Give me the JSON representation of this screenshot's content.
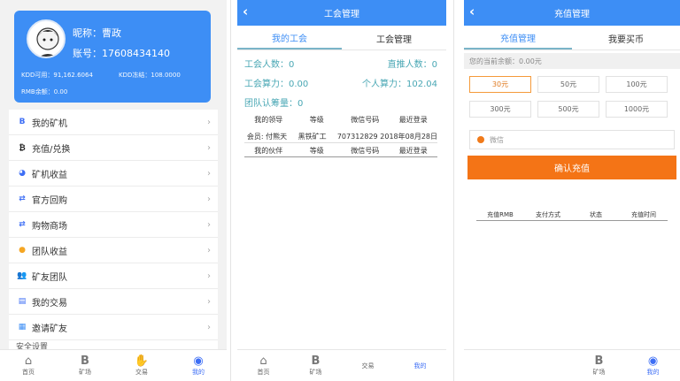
{
  "profile": {
    "nickname": "昵称：曹政",
    "account": "账号：17608434140",
    "available": "KDD可用：91,162.6064",
    "frozen": "KDD冻结：108.0000",
    "balance": "RMB余额：0.00"
  },
  "menu": [
    {
      "icon": "B",
      "icon_name": "bitcoin-b-icon",
      "label": "我的矿机"
    },
    {
      "icon": "₿",
      "icon_name": "bitcoin-icon",
      "label": "充值/兑换"
    },
    {
      "icon": "◕",
      "icon_name": "pie-chart-icon",
      "label": "矿机收益"
    },
    {
      "icon": "⇄",
      "icon_name": "exchange-icon",
      "label": "官方回购"
    },
    {
      "icon": "⇄",
      "icon_name": "exchange-icon",
      "label": "购物商场"
    },
    {
      "icon": "●",
      "icon_name": "coin-icon",
      "label": "团队收益"
    },
    {
      "icon": "👥",
      "icon_name": "team-icon",
      "label": "矿友团队"
    },
    {
      "icon": "▤",
      "icon_name": "document-icon",
      "label": "我的交易"
    },
    {
      "icon": "▦",
      "icon_name": "qr-code-icon",
      "label": "邀请矿友"
    }
  ],
  "menu_partial": "安全设置",
  "tabbar1": [
    "首页",
    "矿场",
    "交易",
    "我的"
  ],
  "union": {
    "title": "工会管理",
    "tabs": [
      "我的工会",
      "工会管理"
    ],
    "members": "工会人数：0",
    "direct": "直推人数：0",
    "union_power": "工会算力：0.00",
    "personal_power": "个人算力：102.04",
    "team_cert": "团队认筹量：0",
    "leader_headers": [
      "我的领导",
      "等级",
      "微信号码",
      "最近登录"
    ],
    "leader_row": [
      "会员: 付熊天",
      "黑铁矿工",
      "707312829",
      "2018年08月28日"
    ],
    "partner_headers": [
      "我的伙伴",
      "等级",
      "微信号码",
      "最近登录"
    ]
  },
  "tabbar2": [
    "首页",
    "矿场",
    "交易",
    "我的"
  ],
  "recharge": {
    "title": "充值管理",
    "tabs": [
      "充值管理",
      "我要买币"
    ],
    "balance": "您的当前余额：0.00元",
    "amounts": [
      "30元",
      "50元",
      "100元",
      "300元",
      "500元",
      "1000元"
    ],
    "method": "微信",
    "confirm": "确认充值",
    "record_headers": [
      "充值RMB",
      "支付方式",
      "状态",
      "充值时间"
    ]
  },
  "tabbar3": [
    "矿场",
    "我的"
  ],
  "colors": {
    "primary": "#3d8ef5",
    "accent": "#f47416",
    "teal": "#49a7b4"
  }
}
